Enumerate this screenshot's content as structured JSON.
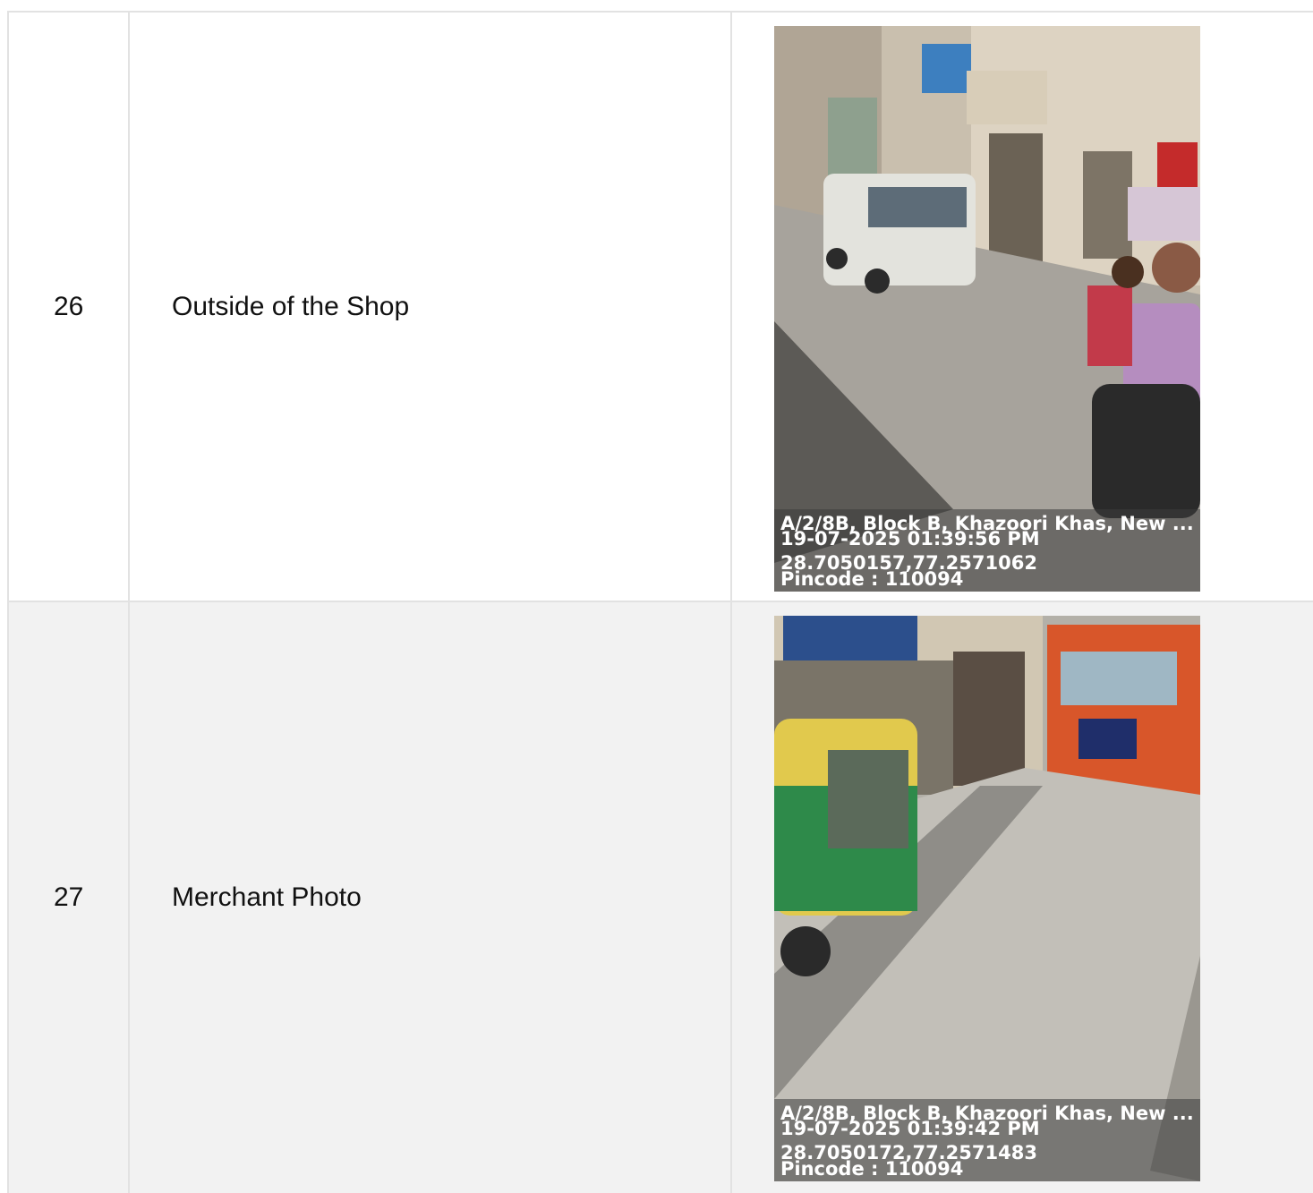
{
  "rows": [
    {
      "number": "26",
      "label": "Outside of the Shop",
      "photo": {
        "description_icon": "street-photo",
        "stamp_address": "A/2/8B, Block B, Khazoori Khas, New ...",
        "stamp_datetime": "19-07-2025 01:39:56 PM",
        "stamp_coords": "28.7050157,77.2571062",
        "stamp_pincode": "Pincode : 110094"
      }
    },
    {
      "number": "27",
      "label": "Merchant Photo",
      "photo": {
        "description_icon": "street-photo",
        "stamp_address": "A/2/8B, Block B, Khazoori Khas, New ...",
        "stamp_datetime": "19-07-2025 01:39:42 PM",
        "stamp_coords": "28.7050172,77.2571483",
        "stamp_pincode": "Pincode : 110094"
      }
    }
  ]
}
